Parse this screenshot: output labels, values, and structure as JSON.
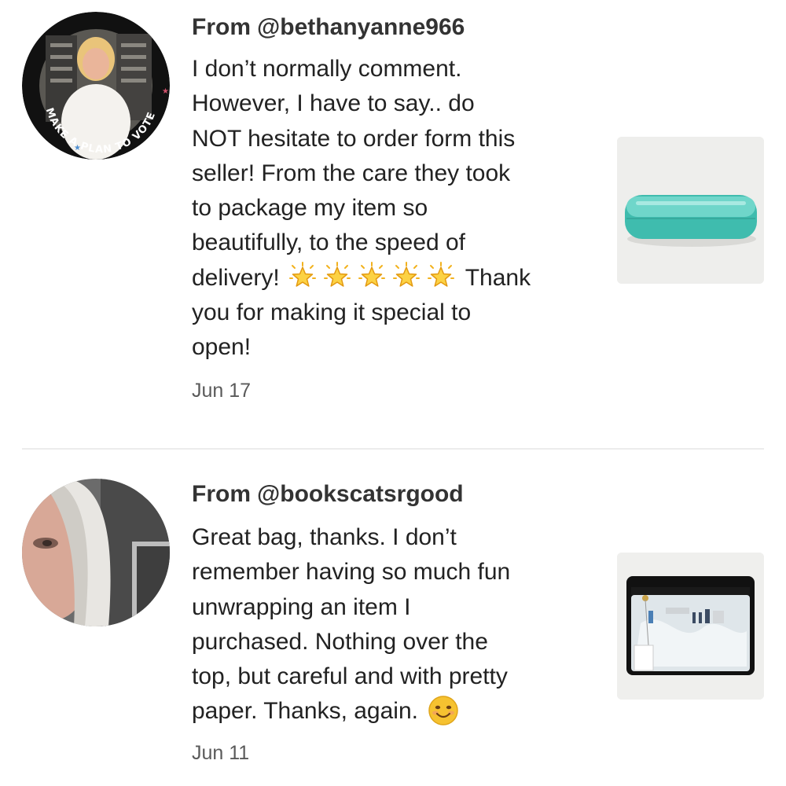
{
  "reviews": [
    {
      "from_label": "From",
      "username": "@bethanyanne966",
      "avatar_badge_text": "MAKE A PLAN TO VOTE",
      "lines": [
        "I don’t normally comment.",
        "However, I have to say.. do",
        "NOT hesitate to order form this",
        "seller! From the care they took",
        "to package my item so",
        "beautifully, to the speed of",
        "delivery!",
        "Thank",
        "you for making it special to",
        "open!"
      ],
      "star_count": 5,
      "star_icon": "glowing-star-emoji",
      "date": "Jun 17",
      "thumbnail": "teal-glasses-case"
    },
    {
      "from_label": "From",
      "username": "@bookscatsrgood",
      "lines": [
        "Great bag, thanks. I don’t",
        "remember having so much fun",
        "unwrapping an item I",
        "purchased. Nothing over the",
        "top, but careful and with pretty",
        "paper. Thanks, again."
      ],
      "trailing_icon": "smiling-face-emoji",
      "date": "Jun 11",
      "thumbnail": "clear-zip-pouch"
    }
  ],
  "colors": {
    "username": "#333333",
    "body_text": "#222222",
    "date": "#5a5a5a",
    "divider": "#ececec",
    "teal_case": "#4fc9bd"
  }
}
